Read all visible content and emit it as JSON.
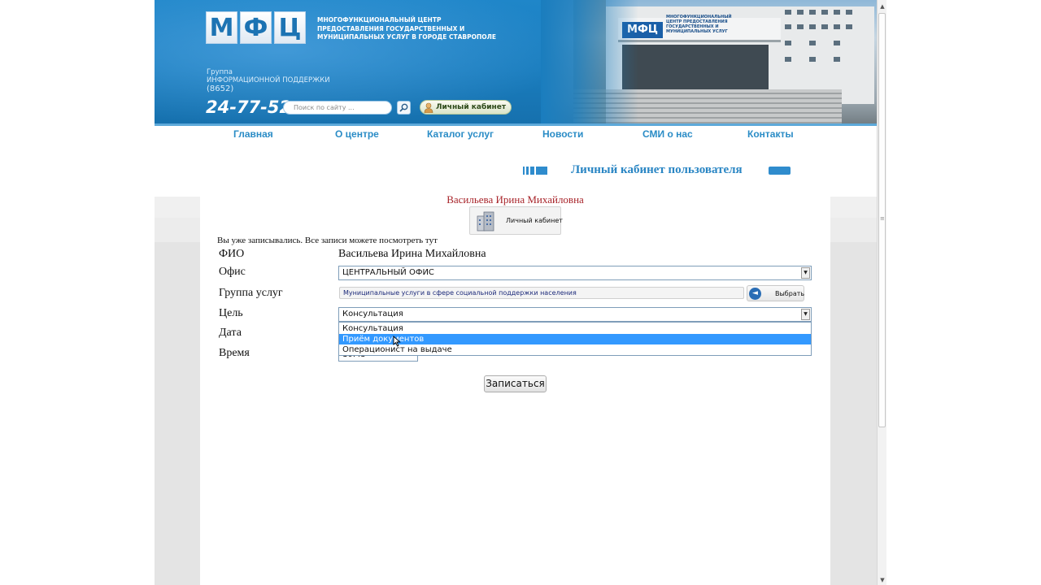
{
  "header": {
    "logo_letters": [
      "М",
      "Ф",
      "Ц"
    ],
    "logo_text": "Многофункциональный центр предоставления государственных и муниципальных услуг в городе Ставрополе",
    "support_label_1": "Группа",
    "support_label_2": "ИНФОРМАЦИОННОЙ ПОДДЕРЖКИ",
    "support_code": "(8652)",
    "phone": "24-77-52",
    "search_placeholder": "Поиск по сайту ...",
    "cabinet_button": "Личный кабинет",
    "photo_sign": "МФЦ",
    "photo_sign_text": "Многофункциональный центр предоставления государственных и муниципальных услуг"
  },
  "nav": {
    "items": [
      "Главная",
      "О центре",
      "Каталог услуг",
      "Новости",
      "СМИ о нас",
      "Контакты"
    ]
  },
  "section_title": "Личный кабинет пользователя",
  "user": {
    "name": "Васильева Ирина Михайловна",
    "cabinet_card_label": "Личный кабинет"
  },
  "notice": "Вы уже записывались. Все записи можете посмотреть тут",
  "form": {
    "labels": {
      "fio": "ФИО",
      "office": "Офис",
      "service_group": "Группа услуг",
      "goal": "Цель",
      "date": "Дата",
      "time": "Время"
    },
    "fio_value": "Васильева Ирина Михайловна",
    "office_value": "ЦЕНТРАЛЬНЫЙ ОФИС",
    "service_group_value": "Муниципальные услуги в сфере социальной поддержки населения",
    "choose_button": "Выбрать",
    "goal_value": "Консультация",
    "goal_options": [
      "Консультация",
      "Приём документов",
      "Операционист на выдаче"
    ],
    "goal_highlighted_index": 1,
    "time_value": "10:45",
    "submit_button": "Записаться"
  },
  "colors": {
    "header_blue": "#1a7dbe",
    "nav_link": "#2a8cc6",
    "user_name": "#a8242a",
    "option_highlight": "#3399ff"
  }
}
